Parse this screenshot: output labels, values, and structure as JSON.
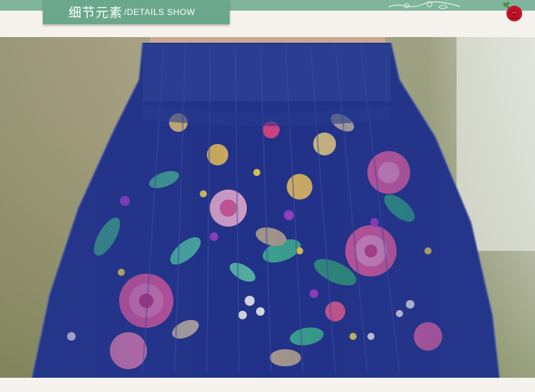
{
  "header": {
    "title_cn": "细节元素",
    "title_en": "/DETAILS SHOW"
  },
  "colors": {
    "band": "#7fb59c",
    "tab": "#6aa78c",
    "navy": "#1f2f86",
    "rose": "#c4122a"
  },
  "icons": {
    "ornament": "floral-ornament-icon",
    "rose": "rose-icon"
  }
}
